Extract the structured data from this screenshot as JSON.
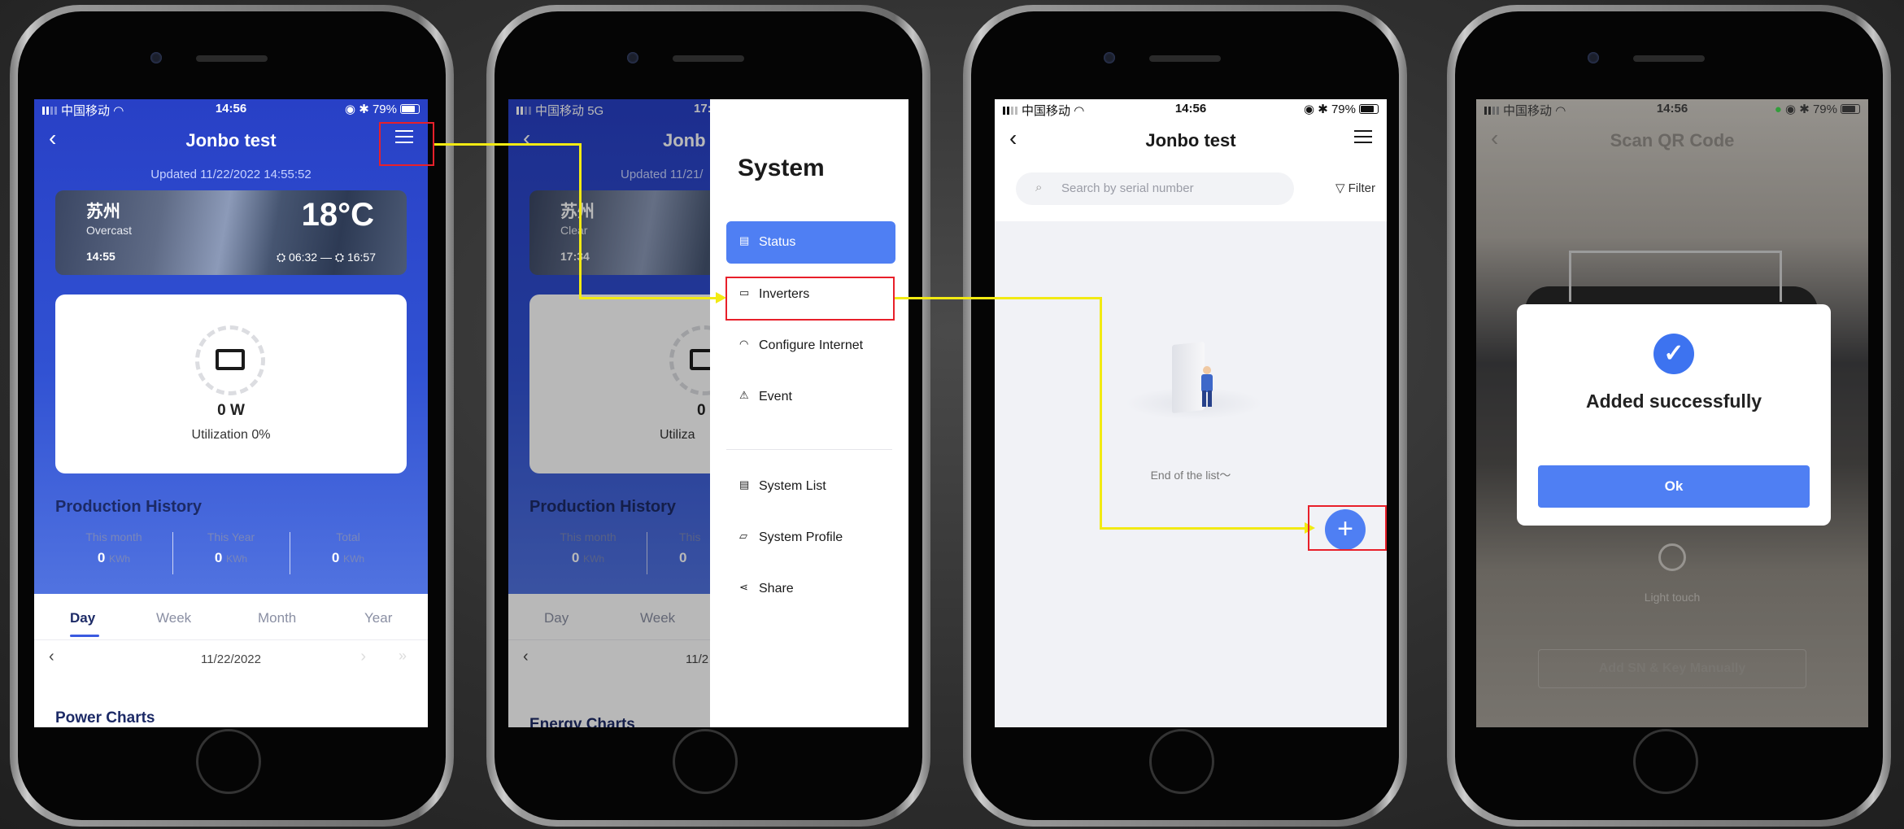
{
  "screen1": {
    "carrier": "中国移动",
    "time": "14:56",
    "battery": "79%",
    "title": "Jonbo test",
    "updated": "Updated 11/22/2022 14:55:52",
    "weather": {
      "city": "苏州",
      "condition": "Overcast",
      "temp": "18°C",
      "clock": "14:55",
      "sunrise": "06:32",
      "sunset": "16:57"
    },
    "power": "0 W",
    "utilization": "Utilization 0%",
    "history_title": "Production History",
    "stats": [
      {
        "label": "This month",
        "value": "0",
        "unit": "KWh"
      },
      {
        "label": "This Year",
        "value": "0",
        "unit": "KWh"
      },
      {
        "label": "Total",
        "value": "0",
        "unit": "KWh"
      }
    ],
    "tabs": [
      "Day",
      "Week",
      "Month",
      "Year"
    ],
    "date": "11/22/2022",
    "charts_title": "Power Charts"
  },
  "screen2": {
    "carrier": "中国移动",
    "network": "5G",
    "time": "17:",
    "title": "Jonb",
    "updated": "Updated 11/21/",
    "weather": {
      "city": "苏州",
      "condition": "Clear",
      "clock": "17:34"
    },
    "power": "0",
    "utilization": "Utiliza",
    "history_title": "Production History",
    "stats": [
      {
        "label": "This month",
        "value": "0",
        "unit": "KWh"
      },
      {
        "label": "This",
        "value": "0"
      }
    ],
    "tabs": [
      "Day",
      "Week"
    ],
    "date": "11/2",
    "charts_title": "Energy Charts",
    "drawer": {
      "title": "System",
      "items": [
        "Status",
        "Inverters",
        "Configure Internet",
        "Event"
      ],
      "items2": [
        "System List",
        "System Profile",
        "Share"
      ]
    }
  },
  "screen3": {
    "carrier": "中国移动",
    "time": "14:56",
    "battery": "79%",
    "title": "Jonbo test",
    "search_placeholder": "Search by serial number",
    "filter": "Filter",
    "empty_text": "End of the list～"
  },
  "screen4": {
    "carrier": "中国移动",
    "time": "14:56",
    "battery": "79%",
    "title": "Scan QR Code",
    "dialog_text": "Added successfully",
    "ok": "Ok",
    "light": "Light touch",
    "manual": "Add SN & Key Manually"
  },
  "colors": {
    "accent": "#4f7ff3",
    "header_blue": "#2f4bd1",
    "annotation_red": "#e8202a",
    "annotation_yellow": "#f2ea13"
  }
}
